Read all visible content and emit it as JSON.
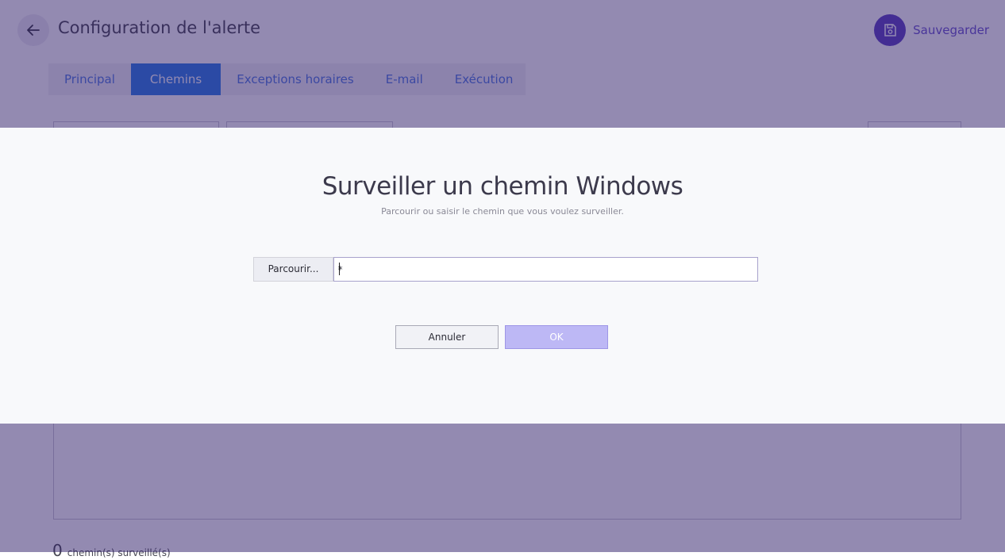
{
  "header": {
    "title": "Configuration de l'alerte",
    "save_label": "Sauvegarder"
  },
  "tabs": [
    {
      "label": "Principal",
      "active": false
    },
    {
      "label": "Chemins",
      "active": true
    },
    {
      "label": "Exceptions horaires",
      "active": false
    },
    {
      "label": "E-mail",
      "active": false
    },
    {
      "label": "Exécution",
      "active": false
    }
  ],
  "status": {
    "count": "0",
    "text": "chemin(s) surveillé(s)"
  },
  "dialog": {
    "title": "Surveiller un chemin Windows",
    "subtitle": "Parcourir ou saisir le chemin que vous voulez surveiller.",
    "browse_label": "Parcourir...",
    "path_value": "*",
    "cancel_label": "Annuler",
    "ok_label": "OK"
  },
  "icons": {
    "back": "arrow-left-icon",
    "save": "floppy-disk-icon"
  },
  "colors": {
    "overlay": "#281664",
    "accent": "#5e45c2",
    "active_tab": "#2f7fe7",
    "tab_text": "#4f7be0",
    "ok_button": "#bdb8f5"
  }
}
